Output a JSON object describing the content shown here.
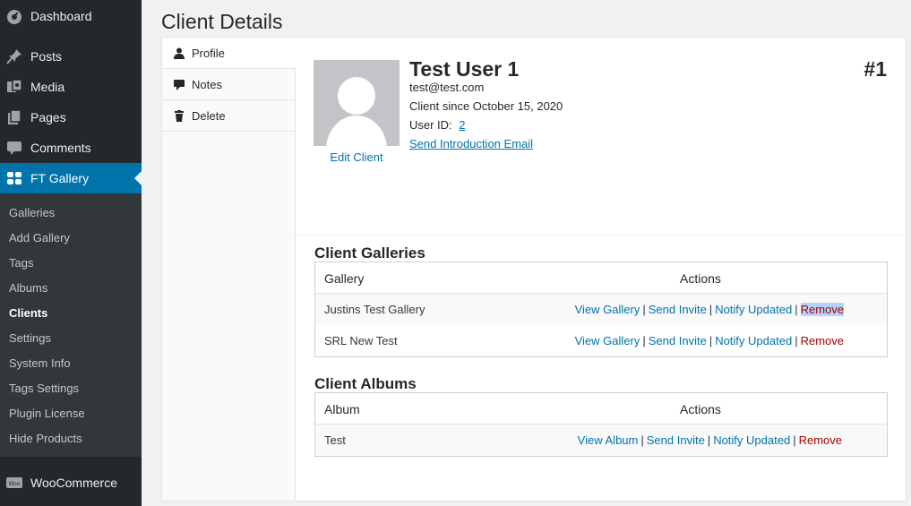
{
  "sidebar": {
    "top_items": [
      {
        "label": "Dashboard",
        "icon": "dashboard-icon"
      },
      {
        "label": "Posts",
        "icon": "pin-icon"
      },
      {
        "label": "Media",
        "icon": "media-icon"
      },
      {
        "label": "Pages",
        "icon": "pages-icon"
      },
      {
        "label": "Comments",
        "icon": "comment-icon"
      },
      {
        "label": "FT Gallery",
        "icon": "gallery-logo-icon"
      },
      {
        "label": "WooCommerce",
        "icon": "woo-icon"
      }
    ],
    "woo_badge": "Woo",
    "submenu": [
      "Galleries",
      "Add Gallery",
      "Tags",
      "Albums",
      "Clients",
      "Settings",
      "System Info",
      "Tags Settings",
      "Plugin License",
      "Hide Products"
    ],
    "accent": "#0073aa"
  },
  "page": {
    "title": "Client Details",
    "tabs": [
      {
        "label": "Profile",
        "icon": "person-icon"
      },
      {
        "label": "Notes",
        "icon": "speech-bubble-icon"
      },
      {
        "label": "Delete",
        "icon": "trash-icon"
      }
    ]
  },
  "client": {
    "name": "Test User 1",
    "number": "#1",
    "email": "test@test.com",
    "since": "Client since October 15, 2020",
    "user_id_label": "User ID:",
    "user_id": "2",
    "send_email": "Send Introduction Email",
    "edit": "Edit Client"
  },
  "galleries": {
    "title": "Client Galleries",
    "col1": "Gallery",
    "col2": "Actions",
    "rows": [
      {
        "name": "Justins Test Gallery"
      },
      {
        "name": "SRL New Test"
      }
    ],
    "actions": {
      "view": "View Gallery",
      "invite": "Send Invite",
      "notify": "Notify Updated",
      "remove": "Remove"
    }
  },
  "albums": {
    "title": "Client Albums",
    "col1": "Album",
    "col2": "Actions",
    "rows": [
      {
        "name": "Test"
      }
    ],
    "actions": {
      "view": "View Album",
      "invite": "Send Invite",
      "notify": "Notify Updated",
      "remove": "Remove"
    }
  },
  "separator": "|"
}
